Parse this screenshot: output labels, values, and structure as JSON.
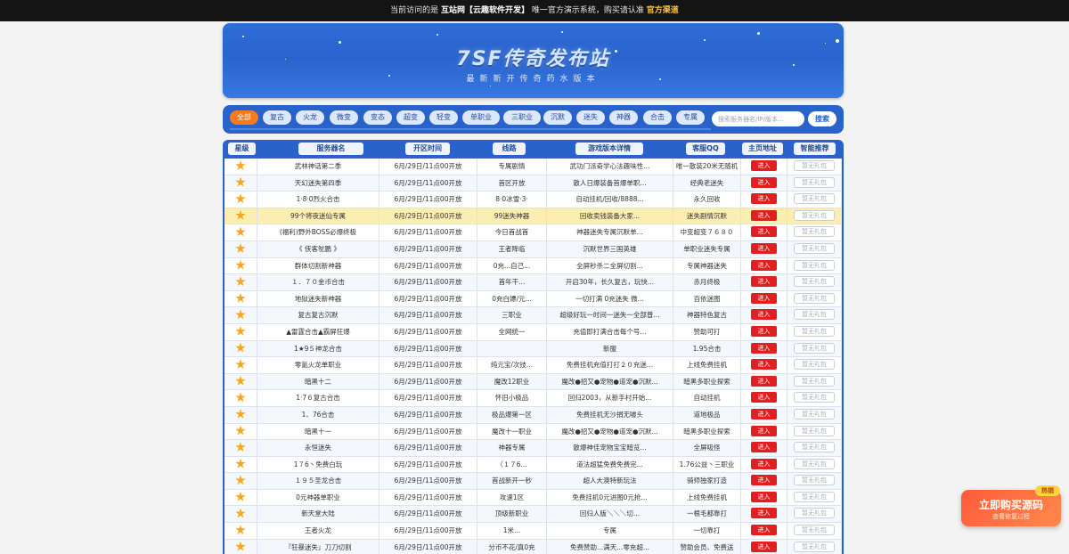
{
  "notice": {
    "prefix": "当前访问的是 ",
    "site": "互站网【云趣软件开发】",
    "middle": " 唯一官方演示系统，购买请认准 ",
    "channel": "官方渠道"
  },
  "banner": {
    "title": "7SF传奇发布站",
    "subtitle": "最新新开传奇药水版本"
  },
  "filter": {
    "tabs": [
      "全部",
      "复古",
      "火龙",
      "微变",
      "变态",
      "超变",
      "轻变",
      "单职业",
      "三职业",
      "沉默",
      "迷失",
      "神器",
      "合击",
      "专属"
    ],
    "active_tab": "全部",
    "search_placeholder": "搜索服务器名/IP/版本...",
    "search_button": "搜索"
  },
  "table": {
    "headers": [
      "星级",
      "服务器名",
      "开区时间",
      "线路",
      "游戏版本详情",
      "客服QQ",
      "主页地址",
      "智能推荐"
    ],
    "enter_label": "进入",
    "gift_label": "暂无礼包",
    "rows": [
      {
        "name": "武林神话第二季",
        "time": "6月/29日/11点00开放",
        "line": "专属剧情",
        "detail": "武功门派奇学心法趣味性...",
        "qq": "唯一散装20米无随机"
      },
      {
        "name": "天幻迷失第四季",
        "time": "6月/29日/11点00开放",
        "line": "首区开放",
        "detail": "散人日爆装备首爆单职...",
        "qq": "经典老迷失"
      },
      {
        "name": "1·8·0烈火合击",
        "time": "6月/29日/11点00开放",
        "line": "8·0冰雪·3·",
        "detail": "自动挂机/回收/8888...",
        "qq": "永久回收"
      },
      {
        "name": "99个将夜迷仙专属",
        "time": "6月/29日/11点00开放",
        "line": "99迷失神器",
        "detail": "回收卖钱装备大家...",
        "qq": "迷失剧情沉默"
      },
      {
        "name": "(福利)野外BOSS必爆终极",
        "time": "6月/29日/11点00开放",
        "line": "今日首战首",
        "detail": "神器迷失专属沉默单...",
        "qq": "中变超变７６８０"
      },
      {
        "name": "《 侠客鸵鹏 》",
        "time": "6月/29日/11点00开放",
        "line": "王者降临",
        "detail": "沉默世界三国英雄",
        "qq": "单职业迷失专属"
      },
      {
        "name": "群体切割新神器",
        "time": "6月/29日/11点00开放",
        "line": "0充...自己...",
        "detail": "全屏秒杀二全屏切割...",
        "qq": "专属神器迷失"
      },
      {
        "name": "１．７０金币合击",
        "time": "6月/29日/11点00开放",
        "line": "首年干...",
        "detail": "开启30年，长久复古，玩快...",
        "qq": "赤月终极"
      },
      {
        "name": "地狱迷失新神器",
        "time": "6月/29日/11点00开放",
        "line": "0充白嫖/元...",
        "detail": "一切打满 0充迷失 微...",
        "qq": "百依迷图"
      },
      {
        "name": "复古复古沉默",
        "time": "6月/29日/11点00开放",
        "line": "三职业",
        "detail": "超级好玩一时间一迷失一全部普...",
        "qq": "神器特色复古"
      },
      {
        "name": "▲雷霆合击▲霸屏狂爆",
        "time": "6月/29日/11点00开放",
        "line": "全网统一",
        "detail": "充值即打满合击每个号...",
        "qq": "赞助可打"
      },
      {
        "name": "1★9５神龙合击",
        "time": "6月/29日/11点00开放",
        "line": "",
        "detail": "新服",
        "qq": "1.95合击"
      },
      {
        "name": "零氪火龙单职业",
        "time": "6月/29日/11点00开放",
        "line": "纯元宝/次技...",
        "detail": "免费挂机充值打打２０充迷...",
        "qq": "上线免费挂机"
      },
      {
        "name": "暗黑十二",
        "time": "6月/29日/11点00开放",
        "line": "魔改12职业",
        "detail": "魔改●招又●宠物●道宠●沉默...",
        "qq": "暗黑多职业探索"
      },
      {
        "name": "1·7６复古合击",
        "time": "6月/29日/11点00开放",
        "line": "怀旧小极品",
        "detail": "回归2003，从新手村开始...",
        "qq": "自动挂机"
      },
      {
        "name": "1、76合击",
        "time": "6月/29日/11点00开放",
        "line": "极品爆第一区",
        "detail": "免费挂机无沙捐无噱头",
        "qq": "道地极品"
      },
      {
        "name": "暗黑十一",
        "time": "6月/29日/11点00开放",
        "line": "魔改十一职业",
        "detail": "魔改●招又●宠物●道宠●沉默...",
        "qq": "暗黑多职业探索"
      },
      {
        "name": "永恒迷失",
        "time": "6月/29日/11点00开放",
        "line": "神器专属",
        "detail": "散爆神佳宠物宝宝暗览...",
        "qq": "全屏吸怪"
      },
      {
        "name": "1７6丶免费白玩",
        "time": "6月/29日/11点00开放",
        "line": "（１７6...",
        "detail": "道法超猛免费免费完...",
        "qq": "1.76公益丶三职业"
      },
      {
        "name": "１９５圣龙合击",
        "time": "6月/29日/11点00开放",
        "line": "首战新开一秒",
        "detail": "超人大澳特新玩法",
        "qq": "骑师独家打造"
      },
      {
        "name": "0元神器单职业",
        "time": "6月/29日/11点00开放",
        "line": "攻速1区",
        "detail": "免费挂机0元进图0元抢...",
        "qq": "上线免费挂机"
      },
      {
        "name": "新天堂大陆",
        "time": "6月/29日/11点00开放",
        "line": "顶级新职业",
        "detail": "回归人版＼＼＼切...",
        "qq": "一根毛都靠打"
      },
      {
        "name": "王者火龙",
        "time": "6月/29日/11点00开放",
        "line": "1米...",
        "detail": "专属",
        "qq": "一切靠打"
      },
      {
        "name": "『狂暴迷失』刀刀切割",
        "time": "6月/29日/11点00开放",
        "line": "分币不花/真0充",
        "detail": "免费赞助...满天...零充超...",
        "qq": "赞助会员、免费送"
      }
    ]
  },
  "buy": {
    "title": "立即购买源码",
    "subtitle": "查看修复过程",
    "badge": "热销"
  }
}
